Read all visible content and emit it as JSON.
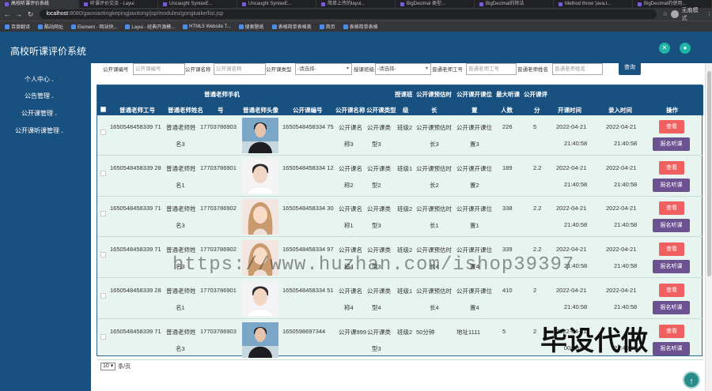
{
  "browser": {
    "tabs": [
      "高校听课评价系统",
      "听课评价交流 - Layui",
      "Uncaught SyntaxE...",
      "Uncaught SyntaxE...",
      "简单上传的layui...",
      "BigDecimal 类型...",
      "BigDecimal的除法",
      "Method throw 'java.l...",
      "BigDecimal的使用..."
    ],
    "url_host": "localhost",
    "url_path": ":8080/gaoxiaotingkepingjiaxitong/jsp/modules/gongkaike/list.jsp",
    "profile_label": "无痕模式",
    "bookmarks": [
      "百度翻译",
      "酷站网址",
      "Element - 网站快...",
      "Layui - 经典开源模...",
      "HTML5 Website T...",
      "搜索壁纸",
      "表格简单表格美",
      "首页",
      "表格简单表格"
    ]
  },
  "app": {
    "title": "高校听课评价系统"
  },
  "sidebar": {
    "items": [
      {
        "label": "个人中心"
      },
      {
        "label": "公告管理"
      },
      {
        "label": "公开课管理"
      },
      {
        "label": "公开课听课管理"
      }
    ]
  },
  "search": {
    "fields": [
      {
        "label": "公开课编号",
        "placeholder": "公开课编号"
      },
      {
        "label": "公开课名称",
        "placeholder": "公开课名称"
      },
      {
        "label": "公开课类型",
        "value": "-请选择-"
      },
      {
        "label": "授课班级",
        "value": "-请选择-"
      },
      {
        "label": "普通老师工号",
        "placeholder": "普通老师工号"
      },
      {
        "label": "普通老师姓名",
        "placeholder": "普通老师姓名"
      }
    ],
    "query_label": "查询"
  },
  "table": {
    "headers": {
      "teacher_phone_top": "普通老师手机",
      "teacher_id": "普通老师工号",
      "teacher_name": "普通老师姓名",
      "phone_bottom": "号",
      "photo": "普通老师头像",
      "course_no": "公开课编号",
      "course_name": "公开课名称",
      "course_type": "公开课类型",
      "class_top": "授课班",
      "class_bottom": "级",
      "duration_top": "公开课预估时",
      "duration_bottom": "长",
      "location_top": "公开课开课位",
      "location_bottom": "置",
      "max_top": "最大听课",
      "max_bottom": "人数",
      "score_top": "公开课评",
      "score_bottom": "分",
      "start_time": "开课时间",
      "entry_time": "录入时间",
      "actions": "操作"
    },
    "rows": [
      {
        "teacher_id": "1650548458339 71",
        "teacher_name_1": "普通老师姓",
        "teacher_name_2": "名3",
        "phone": "17703786903",
        "photo": "male-jacket",
        "course_no": "1650548458334 75",
        "course_name_1": "公开课名",
        "course_name_2": "称3",
        "course_type_1": "公开课类",
        "course_type_2": "型3",
        "class": "班级2",
        "duration_1": "公开课预估时",
        "duration_2": "长3",
        "location_1": "公开课开课位",
        "location_2": "置3",
        "max": "226",
        "score": "5",
        "start_date": "2022-04-21",
        "start_clock": "21:40:58",
        "entry_date": "2022-04-21",
        "entry_clock": "21:40:58"
      },
      {
        "teacher_id": "1650548458339 28",
        "teacher_name_1": "普通老师姓",
        "teacher_name_2": "名1",
        "phone": "17703786901",
        "photo": "male-white",
        "course_no": "1650548458334 12",
        "course_name_1": "公开课名",
        "course_name_2": "称2",
        "course_type_1": "公开课类",
        "course_type_2": "型2",
        "class": "班级1",
        "duration_1": "公开课预估时",
        "duration_2": "长2",
        "location_1": "公开课开课位",
        "location_2": "置2",
        "max": "189",
        "score": "2.2",
        "start_date": "2022-04-21",
        "start_clock": "21:40:58",
        "entry_date": "2022-04-21",
        "entry_clock": "21:40:58"
      },
      {
        "teacher_id": "1650548458339 71",
        "teacher_name_1": "普通老师姓",
        "teacher_name_2": "名3",
        "phone": "17703786902",
        "photo": "female",
        "course_no": "1650548458334 30",
        "course_name_1": "公开课名",
        "course_name_2": "称1",
        "course_type_1": "公开课类",
        "course_type_2": "型3",
        "class": "班级2",
        "duration_1": "公开课预估时",
        "duration_2": "长1",
        "location_1": "公开课开课位",
        "location_2": "置1",
        "max": "338",
        "score": "2.2",
        "start_date": "2022-04-21",
        "start_clock": "21:40:58",
        "entry_date": "2022-04-21",
        "entry_clock": "21:40:58"
      },
      {
        "teacher_id": "1650548458339 71",
        "teacher_name_1": "普通老师姓",
        "teacher_name_2": "名3",
        "phone": "17703786902",
        "photo": "female",
        "course_no": "1650548458334 97",
        "course_name_1": "公开课名",
        "course_name_2": "称4",
        "course_type_1": "公开课类",
        "course_type_2": "型3",
        "class": "班级2",
        "duration_1": "公开课预估时",
        "duration_2": "长4",
        "location_1": "公开课开课位",
        "location_2": "置4",
        "max": "339",
        "score": "2.2",
        "start_date": "2022-04-21",
        "start_clock": "21:40:58",
        "entry_date": "2022-04-21",
        "entry_clock": "21:40:58"
      },
      {
        "teacher_id": "1650548458339 28",
        "teacher_name_1": "普通老师姓",
        "teacher_name_2": "名1",
        "phone": "17703786901",
        "photo": "male-white",
        "course_no": "1650548458334 51",
        "course_name_1": "公开课名",
        "course_name_2": "称4",
        "course_type_1": "公开课类",
        "course_type_2": "型4",
        "class": "班级1",
        "duration_1": "公开课预估时",
        "duration_2": "长4",
        "location_1": "公开课开课位",
        "location_2": "置4",
        "max": "410",
        "score": "2",
        "start_date": "2022-04-21",
        "start_clock": "21:40:58",
        "entry_date": "2022-04-21",
        "entry_clock": "21:40:58"
      },
      {
        "teacher_id": "1650548458339 71",
        "teacher_name_1": "普通老师姓",
        "teacher_name_2": "名3",
        "phone": "17703786903",
        "photo": "male-jacket",
        "course_no": "1650598697344",
        "course_name_1": "公开课999",
        "course_name_2": "",
        "course_type_1": "公开课类",
        "course_type_2": "型3",
        "class": "班级2",
        "duration_1": "50分钟",
        "duration_2": "",
        "location_1": "地址1111",
        "location_2": "",
        "max": "5",
        "score": "2",
        "start_date": "2022-04-21",
        "start_clock": "00:00:00",
        "entry_date": "",
        "entry_clock": "21:40:58"
      }
    ],
    "view_label": "查看",
    "enroll_label": "报名听课"
  },
  "pager": {
    "page_size": "10",
    "suffix": "条/页"
  },
  "overlay": {
    "watermark": "https://www.huzhan.com/ishop39397",
    "promo": "毕设代做"
  }
}
